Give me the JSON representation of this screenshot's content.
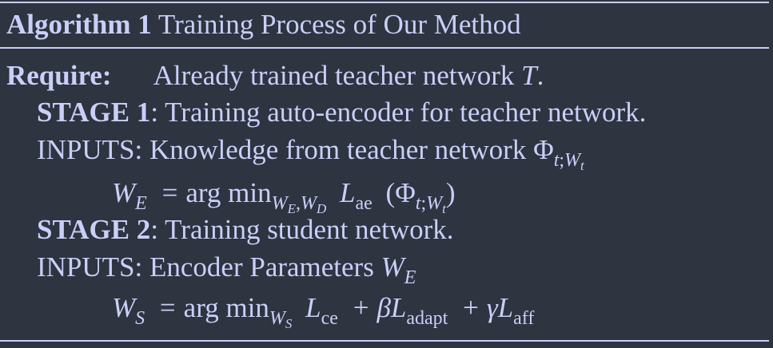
{
  "algorithm": {
    "label": "Algorithm 1",
    "title": "Training Process of Our Method",
    "require_label": "Require:",
    "require_text": "Already trained teacher network",
    "require_symbol": "T",
    "require_period": ".",
    "stage1": {
      "label": "STAGE 1",
      "text": ": Training auto-encoder for teacher network.",
      "inputs_label": "INPUTS:",
      "inputs_text": "Knowledge from teacher network"
    },
    "stage2": {
      "label": "STAGE 2",
      "text": ": Training student network.",
      "inputs_label": "INPUTS:",
      "inputs_text": "Encoder Parameters"
    },
    "math": {
      "phi": "Φ",
      "t": "t",
      "semi": ";",
      "W": "W",
      "E": "E",
      "D": "D",
      "S": "S",
      "L": "L",
      "eq": "=",
      "argmin": "arg min",
      "comma": ",",
      "ae": "ae",
      "ce": "ce",
      "adapt": "adapt",
      "aff": "aff",
      "plus": "+",
      "beta": "β",
      "gamma": "γ",
      "lparen": "(",
      "rparen": ")"
    }
  }
}
